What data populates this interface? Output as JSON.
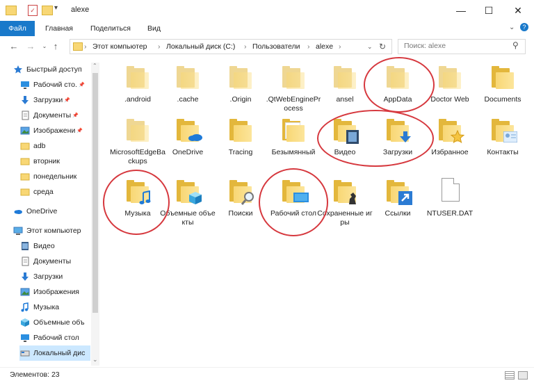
{
  "window": {
    "title": "alexe",
    "controls": {
      "minimize": "—",
      "maximize": "☐",
      "close": "✕"
    }
  },
  "ribbon": {
    "tabs": [
      "Файл",
      "Главная",
      "Поделиться",
      "Вид"
    ]
  },
  "address": {
    "crumbs": [
      "Этот компьютер",
      "Локальный диск (C:)",
      "Пользователи",
      "alexe"
    ],
    "search_placeholder": "Поиск: alexe"
  },
  "nav": {
    "items": [
      {
        "label": "Быстрый доступ",
        "icon": "star-icon",
        "pinned": false
      },
      {
        "label": "Рабочий сто.",
        "icon": "desktop-icon",
        "pinned": true
      },
      {
        "label": "Загрузки",
        "icon": "download-icon",
        "pinned": true
      },
      {
        "label": "Документы",
        "icon": "documents-icon",
        "pinned": true
      },
      {
        "label": "Изображени",
        "icon": "pictures-icon",
        "pinned": true
      },
      {
        "label": "adb",
        "icon": "folder-icon",
        "pinned": false
      },
      {
        "label": "вторник",
        "icon": "folder-icon",
        "pinned": false
      },
      {
        "label": "понедельник",
        "icon": "folder-icon",
        "pinned": false
      },
      {
        "label": "среда",
        "icon": "folder-icon",
        "pinned": false
      },
      {
        "label": "OneDrive",
        "icon": "onedrive-icon",
        "pinned": false
      },
      {
        "label": "Этот компьютер",
        "icon": "computer-icon",
        "pinned": false
      },
      {
        "label": "Видео",
        "icon": "video-icon",
        "pinned": false
      },
      {
        "label": "Документы",
        "icon": "documents-icon",
        "pinned": false
      },
      {
        "label": "Загрузки",
        "icon": "download-icon",
        "pinned": false
      },
      {
        "label": "Изображения",
        "icon": "pictures-icon",
        "pinned": false
      },
      {
        "label": "Музыка",
        "icon": "music-icon",
        "pinned": false
      },
      {
        "label": "Объемные объ",
        "icon": "3d-objects-icon",
        "pinned": false
      },
      {
        "label": "Рабочий стол",
        "icon": "desktop-icon",
        "pinned": false
      },
      {
        "label": "Локальный дис",
        "icon": "drive-icon",
        "pinned": false
      }
    ]
  },
  "files": [
    {
      "label": ".android",
      "icon": "folder-faded-icon"
    },
    {
      "label": ".cache",
      "icon": "folder-faded-icon"
    },
    {
      "label": ".Origin",
      "icon": "folder-faded-icon"
    },
    {
      "label": ".QtWebEngineProcess",
      "icon": "folder-faded-icon"
    },
    {
      "label": "ansel",
      "icon": "folder-faded-icon"
    },
    {
      "label": "AppData",
      "icon": "folder-faded-icon"
    },
    {
      "label": "Doctor Web",
      "icon": "folder-faded-icon"
    },
    {
      "label": "Documents",
      "icon": "folder-icon"
    },
    {
      "label": "MicrosoftEdgeBackups",
      "icon": "folder-faded-icon"
    },
    {
      "label": "OneDrive",
      "icon": "onedrive-folder-icon"
    },
    {
      "label": "Tracing",
      "icon": "folder-icon"
    },
    {
      "label": "Безымянный",
      "icon": "folder-doc-icon"
    },
    {
      "label": "Видео",
      "icon": "video-folder-icon"
    },
    {
      "label": "Загрузки",
      "icon": "downloads-folder-icon"
    },
    {
      "label": "Избранное",
      "icon": "favorites-folder-icon"
    },
    {
      "label": "Контакты",
      "icon": "contacts-folder-icon"
    },
    {
      "label": "Музыка",
      "icon": "music-folder-icon"
    },
    {
      "label": "Объемные объекты",
      "icon": "3d-objects-folder-icon"
    },
    {
      "label": "Поиски",
      "icon": "searches-folder-icon"
    },
    {
      "label": "Рабочий стол",
      "icon": "desktop-folder-icon"
    },
    {
      "label": "Сохраненные игры",
      "icon": "saved-games-folder-icon"
    },
    {
      "label": "Ссылки",
      "icon": "links-folder-icon"
    },
    {
      "label": "NTUSER.DAT",
      "icon": "file-icon"
    }
  ],
  "status": {
    "count_label": "Элементов: 23"
  },
  "colors": {
    "accent": "#1979ca",
    "annotation": "#d6383e",
    "folder": "#f8d775"
  }
}
